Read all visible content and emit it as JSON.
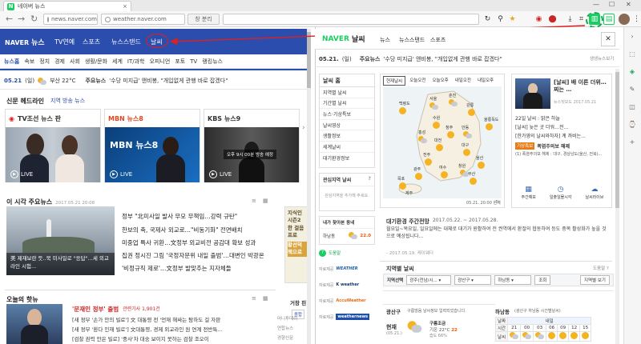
{
  "browser": {
    "tab_title": "네이버 뉴스",
    "url_left": "news.naver.com",
    "url_right": "weather.naver.com",
    "btn_newwin": "창 분리",
    "accent": "#19ce60"
  },
  "left": {
    "logo": "NAVER",
    "logo_news": "뉴스",
    "nav": [
      "TV연예",
      "스포츠",
      "뉴스스탠드",
      "날씨"
    ],
    "menu": [
      "뉴스홈",
      "속보",
      "정치",
      "경제",
      "사회",
      "생활/문화",
      "세계",
      "IT/과학",
      "오피니언",
      "포토",
      "TV",
      "랭킹뉴스"
    ],
    "info_date": "05.21",
    "info_day": "(일)",
    "info_weather": "부산 22°C",
    "info_news_label": "주요뉴스",
    "info_news_text": "'수당 미지급' 앤비봉, \"개입없게 관행 바로 잡겠다\"",
    "headline_title": "신문 헤드라인",
    "headline_alt": "지역 방송 뉴스",
    "tv": [
      {
        "channel": "TV조선 뉴스 판",
        "live": "LIVE"
      },
      {
        "channel": "MBN 뉴스8",
        "live": "LIVE",
        "overlay": "MBN 뉴스8"
      },
      {
        "channel": "KBS 뉴스9",
        "live": "LIVE",
        "overlay": "오후 9시 00분 방송 예정"
      }
    ],
    "main_title": "이 시각 주요뉴스",
    "main_time": "2017.05.21 20:08",
    "main_caption": "美 제재보란 듯..북 미사일로 \"응답\"...세 외교라인 시험...",
    "main_news": [
      "정부 \"北미사일 발사 무모 무책임…강력 규탄\"",
      "한보의 축, 국제사 외교로…\"비동기화\" 전면배치",
      "미중업 특사 귀환…文정부 외교비전 공감대 확보 성과",
      "집권 정시진 그림 '국정자문위 내일 출범'…대변인 박광온",
      "'비정규직 제로'…文정부 발맞추는 지자체들"
    ],
    "ad_text": [
      "지식인",
      "시즌2",
      "한 걸음",
      "프로",
      "황선덕",
      "책으로"
    ],
    "ad_side_label": "거창 핀",
    "ad_tab": "종합",
    "today_title": "오늘의 핫뉴",
    "today_headline": "'문재인 정부' 출범",
    "today_count": "관련기사 1,901건",
    "today_news": [
      "[새 정부 '손가 안의 빌로'] 文 대통령 전 '언재 해싸는 탐하도 걸 자판",
      "[새 정부 '환다 인재 빌로'] 文대통령, 경제 외교라인 원 연계 전반특...",
      "[검찰 권력 안은 빌로] '중사'차 대숭 보이지 못하는 검찰 조오이"
    ],
    "today_sources": [
      "머니투데이",
      "연합뉴스",
      "경향신문"
    ]
  },
  "right": {
    "logo": "NAVER",
    "logo_weather": "날씨",
    "nav": [
      "뉴스",
      "뉴스스탠드",
      "스포츠"
    ],
    "info_date": "05.21.",
    "info_day": "(일)",
    "info_news_label": "주요뉴스",
    "info_news_text": "'수당 미지급' 앤비봉, \"개입없게 관행 바로 잡겠다\"",
    "more_label": "생생뉴스보기",
    "side_title": "날씨 홈",
    "side_items": [
      "지역별 날씨",
      "기간별 날씨",
      "뉴스·기상특보",
      "날씨영상",
      "생활정보",
      "세계날씨",
      "대기환경정보"
    ],
    "fav_title": "관심지역 날씨",
    "fav_hint": "관심지역을 추가해 주세요.",
    "my_weather_title": "내가 찾아본 동네",
    "my_weather_place": "하남동",
    "my_weather_temp": "22.0",
    "cp_labels": [
      "도움말",
      "자료제공",
      "자료제공",
      "자료제공",
      "자료제공"
    ],
    "cp_brands": [
      "WEATHER",
      "K weather",
      "AccuWeather",
      "weathernews"
    ],
    "map_tabs": [
      "현재날씨",
      "오늘오전",
      "오늘오후",
      "내일오전",
      "내일오후"
    ],
    "map_time": "05.21. 20:00 현재",
    "map_cities": [
      "서울",
      "춘천",
      "강릉",
      "수원",
      "청주",
      "대전",
      "홍성",
      "안동",
      "대구",
      "울산",
      "전주",
      "광주",
      "부산",
      "목포",
      "여수",
      "제주",
      "백령도",
      "울릉독도",
      "창원"
    ],
    "news_card_title": "[날씨] 배 이른 더위…찌는 …",
    "news_card_sub": "뉴스및보도 2017.05.21",
    "news_list": [
      "22일 날씨 : 맑은 하늘",
      "[날씨] 늦은 곳 더워…전...",
      "[한가영의 날씨와하자] 계 까비는..."
    ],
    "news_badge": "기상특보",
    "news_alert_title": "폭염주의보 해제",
    "news_alert_text": "(1) 폭염주의보 해제 : 대구, 경상남도(울산, 전북)...",
    "icon_labels": [
      "주간예보",
      "일출일몰시각",
      "날씨라이브"
    ],
    "dust_title": "대기환경 주간전망",
    "dust_period": "2017.05.22. ~ 2017.05.28.",
    "dust_text": "월요일~목요일, 일요일에는 대체로 대기가 원활하여 전 권역에서 환절의 협동하여 등도 중복 활성화가 높을 것으로 예상됩니다...",
    "dust_date": "- 2017.05.19. 케이웨더",
    "local_title": "지역별 날씨",
    "local_more": "도움말 ?",
    "local_select_label": "지역선택",
    "local_selects": [
      "광주(전남/시...",
      "광산구",
      "하남동"
    ],
    "local_btn": "조회",
    "local_btn2": "지역별 보기",
    "gwangsan_label": "광산구",
    "gwangsan_text": "구름많음 날씨정보 입력되었습니다.",
    "hourly_label": "하남동",
    "hourly_note": "(광산구 하남동 시간별날씨)",
    "now_label": "현재",
    "now_time": "(05.21.)",
    "now_desc": "구름조금",
    "now_temp": "기온 22°C",
    "now_extra": "습도 66%",
    "now_temp_big": "22",
    "fc_rows": [
      "날짜",
      "시간",
      "날씨"
    ],
    "fc_day": "내일",
    "fc_times": [
      "21",
      "00",
      "03",
      "06",
      "09",
      "12",
      "15"
    ]
  }
}
